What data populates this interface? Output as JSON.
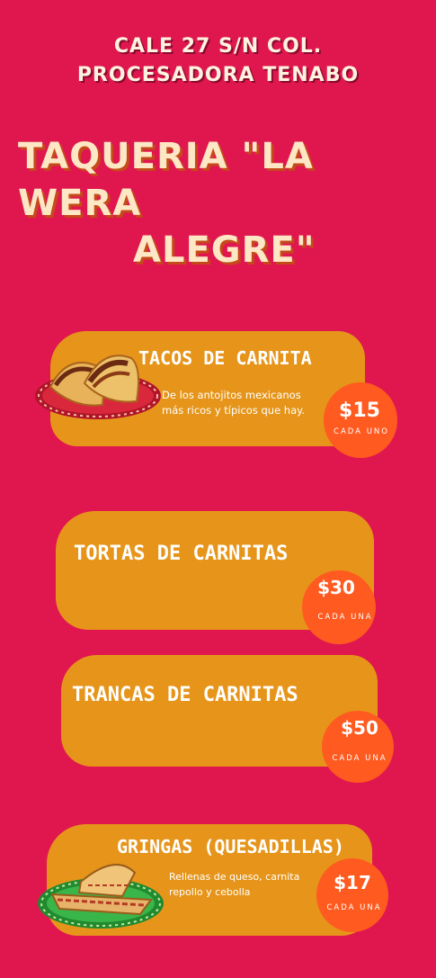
{
  "header": {
    "address_line1": "CALE 27 S/N COL.",
    "address_line2": "PROCESADORA TENABO",
    "title_line1": "TAQUERIA \"LA WERA",
    "title_line2": "ALEGRE\""
  },
  "menu": [
    {
      "name": "TACOS DE CARNITA",
      "description_line1": "De los antojitos mexicanos",
      "description_line2": "más ricos y típicos que hay.",
      "price": "$15",
      "unit": "CADA UNO",
      "icon": "tacos-plate-icon"
    },
    {
      "name": "TORTAS DE CARNITAS",
      "price": "$30",
      "unit": "CADA UNA"
    },
    {
      "name": "TRANCAS DE CARNITAS",
      "price": "$50",
      "unit": "CADA UNA"
    },
    {
      "name": "GRINGAS (QUESADILLAS)",
      "description_line1": "Rellenas de queso, carnita",
      "description_line2": "repollo y cebolla",
      "price": "$17",
      "unit": "CADA UNA",
      "icon": "quesadilla-plate-icon"
    }
  ],
  "colors": {
    "background": "#e0174f",
    "card": "#e6951a",
    "price_blob": "#ff5a1f",
    "title_text": "#fde7c4"
  }
}
